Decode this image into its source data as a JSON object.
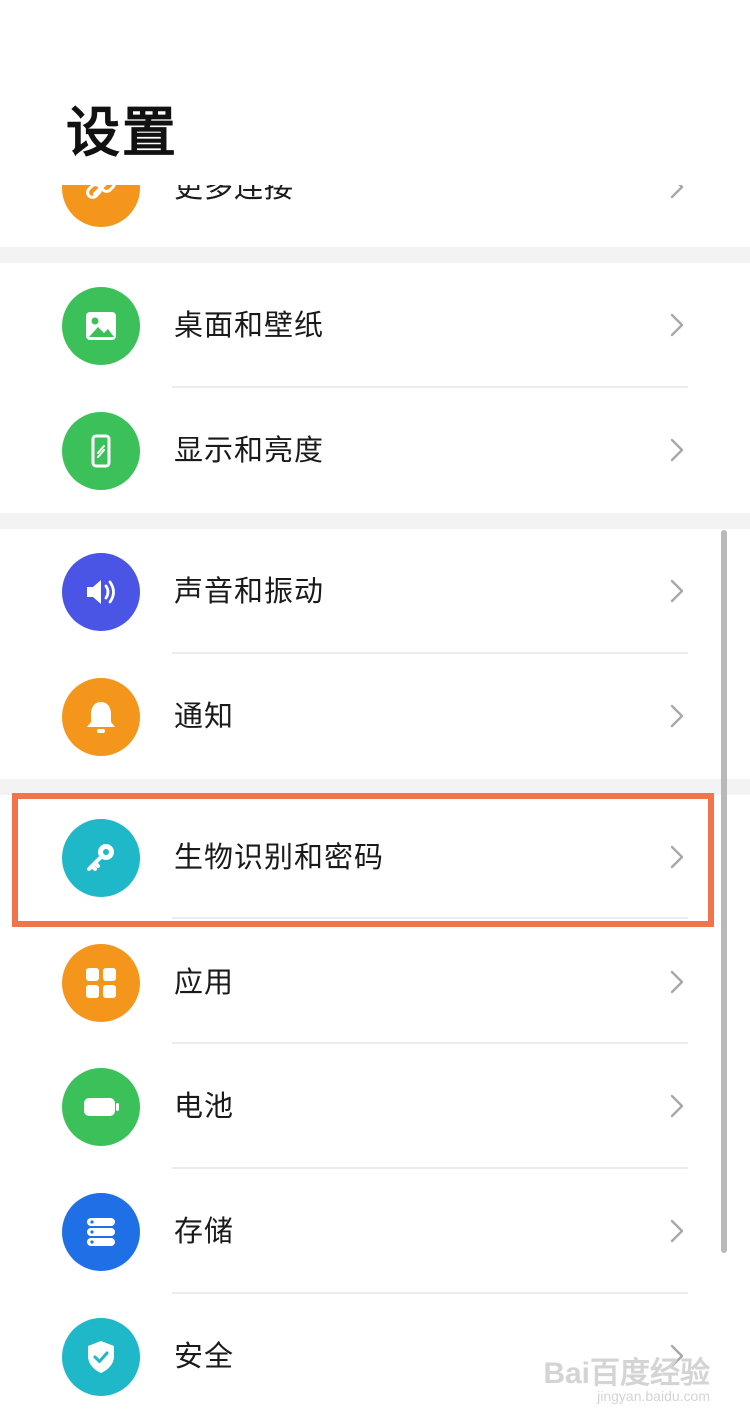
{
  "header": {
    "title": "设置"
  },
  "items": [
    {
      "label": "更多连接",
      "icon": "link-icon",
      "color": "#f5961c"
    },
    {
      "label": "桌面和壁纸",
      "icon": "image-icon",
      "color": "#3cc05a"
    },
    {
      "label": "显示和亮度",
      "icon": "phone-brightness-icon",
      "color": "#3cc05a"
    },
    {
      "label": "声音和振动",
      "icon": "speaker-icon",
      "color": "#4a55e6"
    },
    {
      "label": "通知",
      "icon": "bell-icon",
      "color": "#f5961c"
    },
    {
      "label": "生物识别和密码",
      "icon": "key-icon",
      "color": "#1fb8c8",
      "highlighted": true
    },
    {
      "label": "应用",
      "icon": "apps-grid-icon",
      "color": "#f5961c"
    },
    {
      "label": "电池",
      "icon": "battery-icon",
      "color": "#3cc05a"
    },
    {
      "label": "存储",
      "icon": "storage-icon",
      "color": "#1f6fe6"
    },
    {
      "label": "安全",
      "icon": "shield-icon",
      "color": "#1fb8c8"
    }
  ],
  "highlight_color": "#f2744a",
  "watermark": {
    "main": "Bai百度经验",
    "sub": "jingyan.baidu.com"
  }
}
